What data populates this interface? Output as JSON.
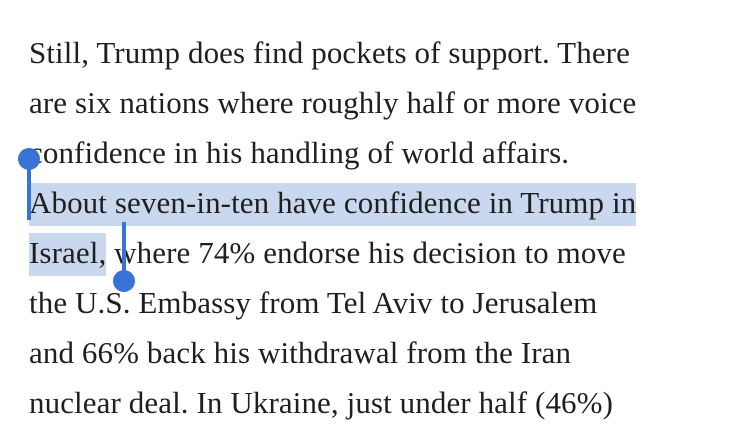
{
  "article": {
    "lines": [
      "Still, Trump does find pockets of support. There",
      "are six nations where roughly half or more voice",
      "confidence in his handling of world affairs.",
      "About seven-in-ten have confidence in Trump in",
      "Israel,",
      " where 74% endorse his decision to move",
      "the U.S. Embassy from Tel Aviv to Jerusalem",
      "and 66% back his withdrawal from the Iran",
      "nuclear deal. In Ukraine, just under half (46%)"
    ]
  },
  "colors": {
    "text": "#1f1f1f",
    "selection_highlight": "#c9d8ee",
    "selection_handle": "#3a73d6"
  }
}
